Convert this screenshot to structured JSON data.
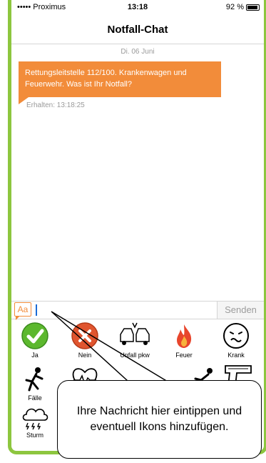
{
  "status_bar": {
    "carrier": "••••• Proximus",
    "time": "13:18",
    "battery": "92 %"
  },
  "header": {
    "title": "Notfall-Chat"
  },
  "conversation": {
    "date": "Di. 06 Juni",
    "message": "Rettungsleitstelle 112/100.  Krankenwagen und Feuerwehr. Was ist Ihr Notfall?",
    "received": "Erhalten: 13:18:25"
  },
  "composer": {
    "aa_label": "Aa",
    "input_value": "",
    "send_label": "Senden"
  },
  "icons": [
    {
      "label": "Ja",
      "icon": "check-icon"
    },
    {
      "label": "Nein",
      "icon": "no-icon"
    },
    {
      "label": "Unfall pkw",
      "icon": "car-crash-icon"
    },
    {
      "label": "Feuer",
      "icon": "fire-icon"
    },
    {
      "label": "Krank",
      "icon": "sick-face-icon"
    },
    {
      "label": "Fälle",
      "icon": "falling-person-icon"
    },
    {
      "label": "",
      "icon": "heart-icon"
    },
    {
      "label": "",
      "icon": "fight-icon"
    },
    {
      "label": "",
      "icon": "gun-icon"
    },
    {
      "label": "Sturm",
      "icon": "storm-icon"
    }
  ],
  "callout": {
    "text": "Ihre Nachricht hier eintippen und eventuell Ikons hinzufügen."
  },
  "colors": {
    "accent_green": "#8dc63f",
    "bubble_orange": "#f28c3a"
  }
}
